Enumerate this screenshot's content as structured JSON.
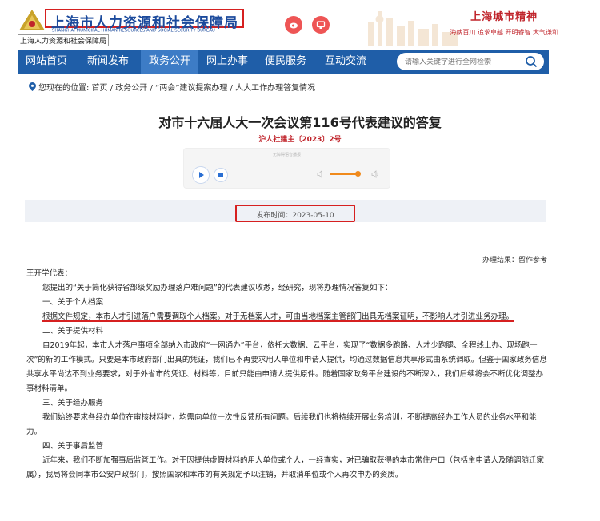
{
  "header": {
    "title": "上海市人力资源和社会保障局",
    "title_en": "SHANGHAI MUNICIPAL HUMAN RESOURCES AND SOCIAL SECURITY BUREAU",
    "subtitle": "上海人力资源和社会保障局",
    "slogan_title": "上海城市精神",
    "slogan_sub": "海纳百川  追求卓越  开明睿智  大气谦和",
    "social_icons": [
      "weibo-icon",
      "wechat-icon"
    ]
  },
  "nav": {
    "items": [
      "网站首页",
      "新闻发布",
      "政务公开",
      "网上办事",
      "便民服务",
      "互动交流"
    ],
    "active_index": 2,
    "search_placeholder": "请输入关键字进行全网检索"
  },
  "breadcrumb": {
    "label": "您现在的位置:",
    "path": "首页 /  政务公开 /  “两会”建议提案办理 /  人大工作办理答复情况"
  },
  "document": {
    "title": "对市十六届人大一次会议第116号代表建议的答复",
    "number": "沪人社建主〔2023〕2号",
    "player_label": "无障碍语音播报",
    "publish_time": "发布时间：2023-05-10",
    "result": "办理结果：留作参考",
    "paragraphs": [
      "王开学代表：",
      "您提出的“关于简化获得省部级奖励办理落户难问题”的代表建议收悉，经研究，现将办理情况答复如下：",
      "一、关于个人档案",
      "根据文件规定，本市人才引进落户需要调取个人档案。对于无档案人才，可由当地档案主管部门出具无档案证明，不影响人才引进业务办理。",
      "二、关于提供材料",
      "自2019年起，本市人才落户事项全部纳入市政府“一网通办”平台，依托大数据、云平台，实现了“数据多跑路、人才少跑腿、全程线上办、现场跑一次”的新的工作模式。只要是本市政府部门出具的凭证，我们已不再要求用人单位和申请人提供，均通过数据信息共享形式由系统调取。但鉴于国家政务信息共享水平尚达不到业务要求，对于外省市的凭证、材料等，目前只能由申请人提供原件。随着国家政务平台建设的不断深入，我们后续将会不断优化调整办事材料清单。",
      "三、关于经办服务",
      "我们始终要求各经办单位在审核材料时，均需向单位一次性反馈所有问题。后续我们也将持续开展业务培训，不断提高经办工作人员的业务水平和能力。",
      "四、关于事后监管",
      "近年来，我们不断加强事后监管工作。对于因提供虚假材料的用人单位或个人，一经查实，对已骗取获得的本市常住户口（包括主申请人及随调随迁家属），我局将会同本市公安户政部门，按照国家和本市的有关规定予以注销，并取消单位或个人再次申办的资质。"
    ]
  },
  "colors": {
    "nav_bg": "#1f5ea8",
    "nav_active": "#3d7cc6",
    "title_blue": "#1b4a9c",
    "accent_red": "#d62020",
    "slogan_red": "#c0242b"
  }
}
